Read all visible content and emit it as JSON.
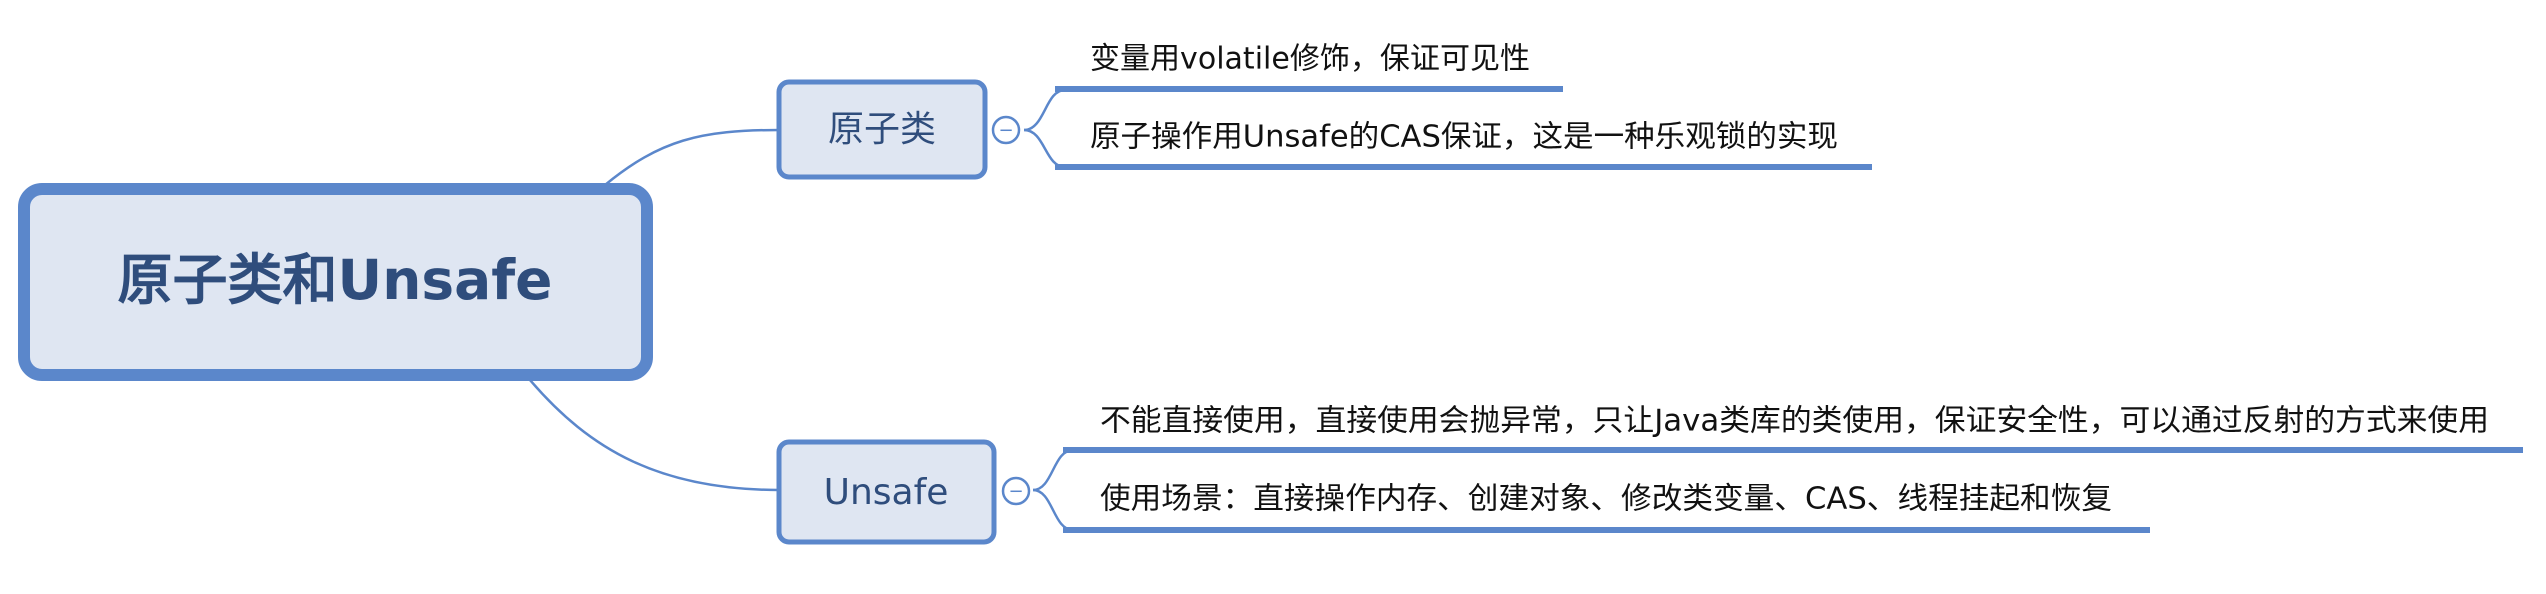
{
  "root": {
    "label": "原子类和Unsafe"
  },
  "branches": [
    {
      "label": "原子类",
      "collapse_symbol": "−",
      "children": [
        {
          "label": "变量用volatile修饰，保证可见性"
        },
        {
          "label": "原子操作用Unsafe的CAS保证，这是一种乐观锁的实现"
        }
      ]
    },
    {
      "label": "Unsafe",
      "collapse_symbol": "−",
      "children": [
        {
          "label": "不能直接使用，直接使用会抛异常，只让Java类库的类使用，保证安全性，可以通过反射的方式来使用"
        },
        {
          "label": "使用场景：直接操作内存、创建对象、修改类变量、CAS、线程挂起和恢复"
        }
      ]
    }
  ],
  "colors": {
    "box_fill": "#dfe6f2",
    "box_stroke": "#5b87cb",
    "connector": "#5b87cb",
    "underline": "#5b87cb",
    "box_text": "#2f4d7c",
    "leaf_text": "#111111"
  }
}
